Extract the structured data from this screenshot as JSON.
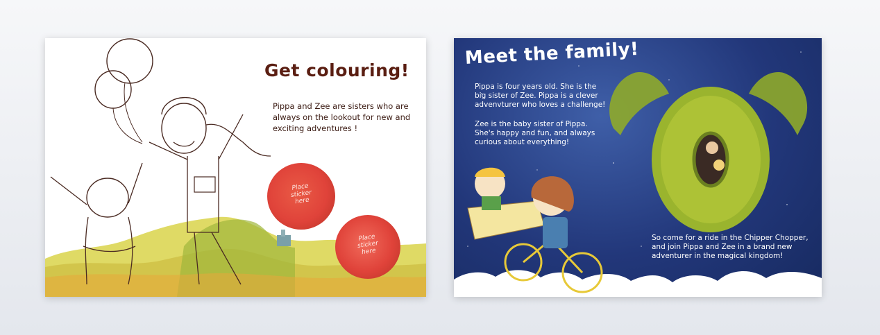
{
  "left_page": {
    "title": "Get colouring!",
    "body": "Pippa and Zee are sisters who are always on the lookout for new and exciting adventures !",
    "sticker_1": {
      "line1": "Place",
      "line2": "sticker",
      "line3": "here"
    },
    "sticker_2": {
      "line1": "Place",
      "line2": "sticker",
      "line3": "here"
    }
  },
  "right_page": {
    "title": "Meet the family!",
    "pippa_text": "Pippa is four years old. She is the big sister of Zee. Pippa is a clever advenvturer who loves a challenge!",
    "zee_text": "Zee is the baby sister of Pippa. She's happy and fun, and always curious about everything!",
    "closing_text": "So come for a ride in the Chipper Chopper, and join Pippa and Zee in a brand new adventurer in the magical kingdom!"
  },
  "colors": {
    "title_brown": "#5a1e12",
    "sky_blue": "#22377a",
    "sticker_red": "#e0433a",
    "hill_green": "#b7c94a"
  }
}
